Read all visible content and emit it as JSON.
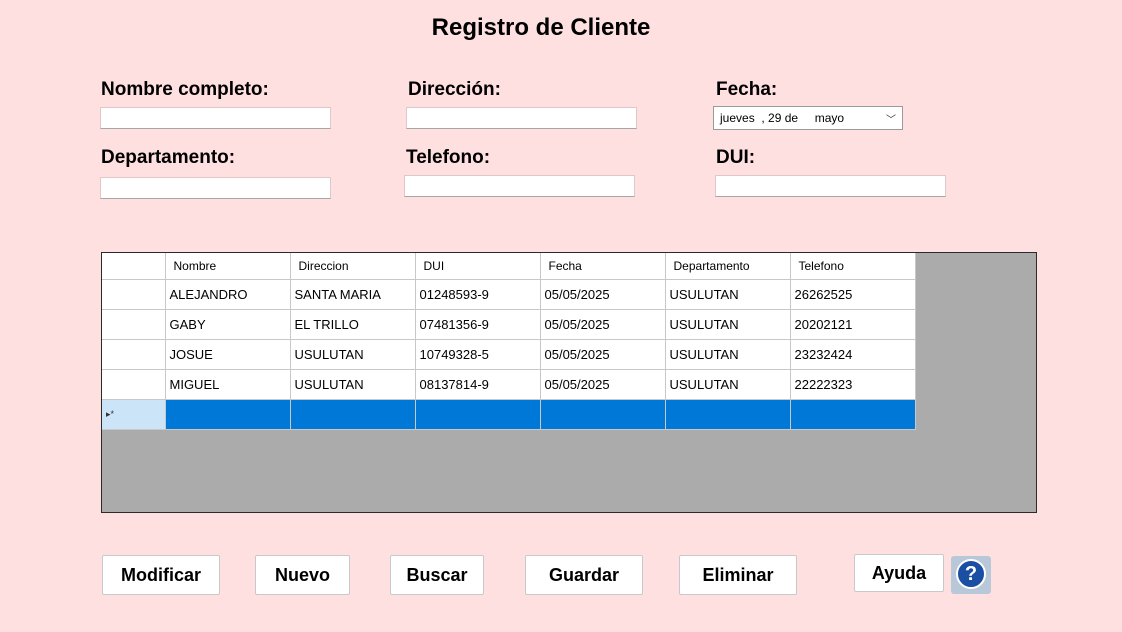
{
  "window": {
    "title": "Registro de Cliente"
  },
  "form": {
    "nombre": {
      "label": "Nombre completo:",
      "value": ""
    },
    "direccion": {
      "label": "Dirección:",
      "value": ""
    },
    "fecha": {
      "label": "Fecha:",
      "value": "jueves  , 29 de     mayo"
    },
    "departamento": {
      "label": "Departamento:",
      "value": ""
    },
    "telefono": {
      "label": "Telefono:",
      "value": ""
    },
    "dui": {
      "label": "DUI:",
      "value": ""
    }
  },
  "grid": {
    "columns": [
      "Nombre",
      "Direccion",
      "DUI",
      "Fecha",
      "Departamento",
      "Telefono"
    ],
    "rows": [
      [
        "ALEJANDRO",
        "SANTA MARIA",
        "01248593-9",
        "05/05/2025",
        "USULUTAN",
        "26262525"
      ],
      [
        "GABY",
        "EL TRILLO",
        "07481356-9",
        "05/05/2025",
        "USULUTAN",
        "20202121"
      ],
      [
        "JOSUE",
        "USULUTAN",
        "10749328-5",
        "05/05/2025",
        "USULUTAN",
        "23232424"
      ],
      [
        "MIGUEL",
        "USULUTAN",
        "08137814-9",
        "05/05/2025",
        "USULUTAN",
        "22222323"
      ]
    ],
    "new_row_marker": "▸*"
  },
  "buttons": {
    "modificar": "Modificar",
    "nuevo": "Nuevo",
    "buscar": "Buscar",
    "guardar": "Guardar",
    "eliminar": "Eliminar",
    "ayuda": "Ayuda"
  },
  "icons": {
    "help": "question-circle-icon"
  },
  "colors": {
    "background": "#ffe0e0",
    "selection": "#0078d7",
    "grid_bg": "#ababab"
  }
}
